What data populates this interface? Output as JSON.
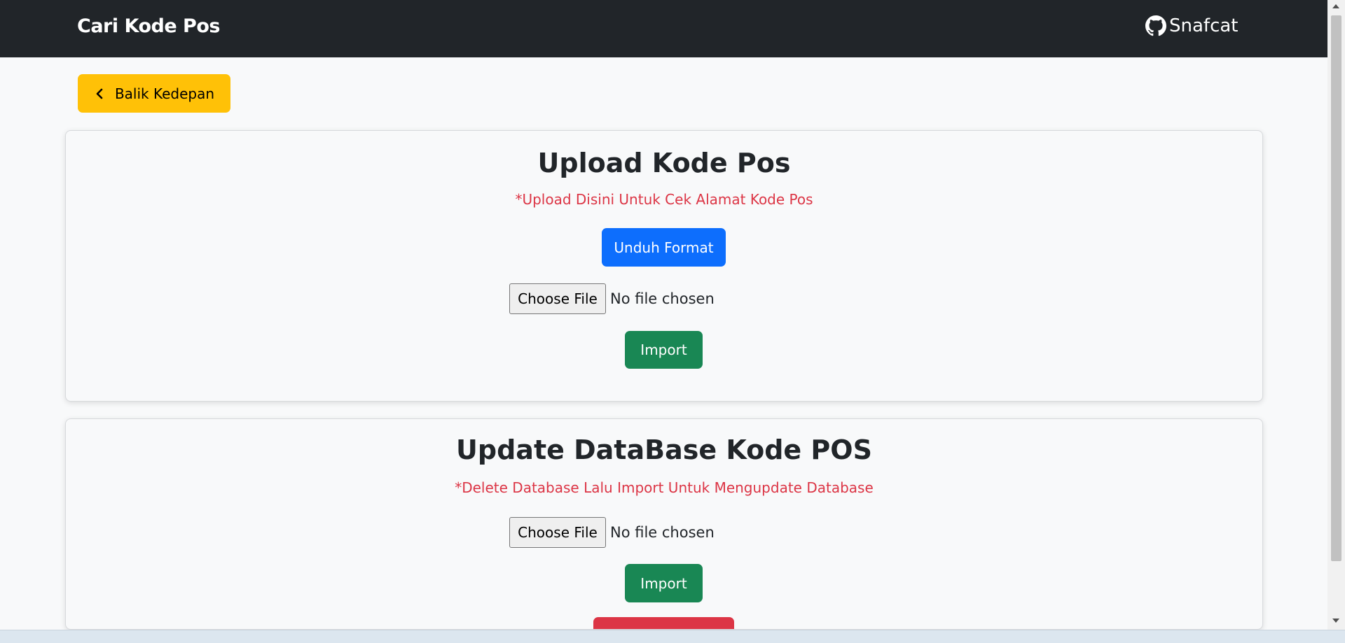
{
  "navbar": {
    "brand": "Cari Kode Pos",
    "github_label": "Snafcat"
  },
  "back_button": {
    "label": "Balik Kedepan"
  },
  "upload_card": {
    "title": "Upload Kode Pos",
    "note": "*Upload Disini Untuk Cek Alamat Kode Pos",
    "download_label": "Unduh Format",
    "file_button": "Choose File",
    "file_status": "No file chosen",
    "import_label": "Import"
  },
  "update_card": {
    "title": "Update DataBase Kode POS",
    "note": "*Delete Database Lalu Import Untuk Mengupdate Database",
    "file_button": "Choose File",
    "file_status": "No file chosen",
    "import_label": "Import"
  },
  "colors": {
    "navbar": "#212529",
    "warning": "#ffc107",
    "primary": "#0d6efd",
    "success": "#198754",
    "danger": "#dc3545"
  }
}
